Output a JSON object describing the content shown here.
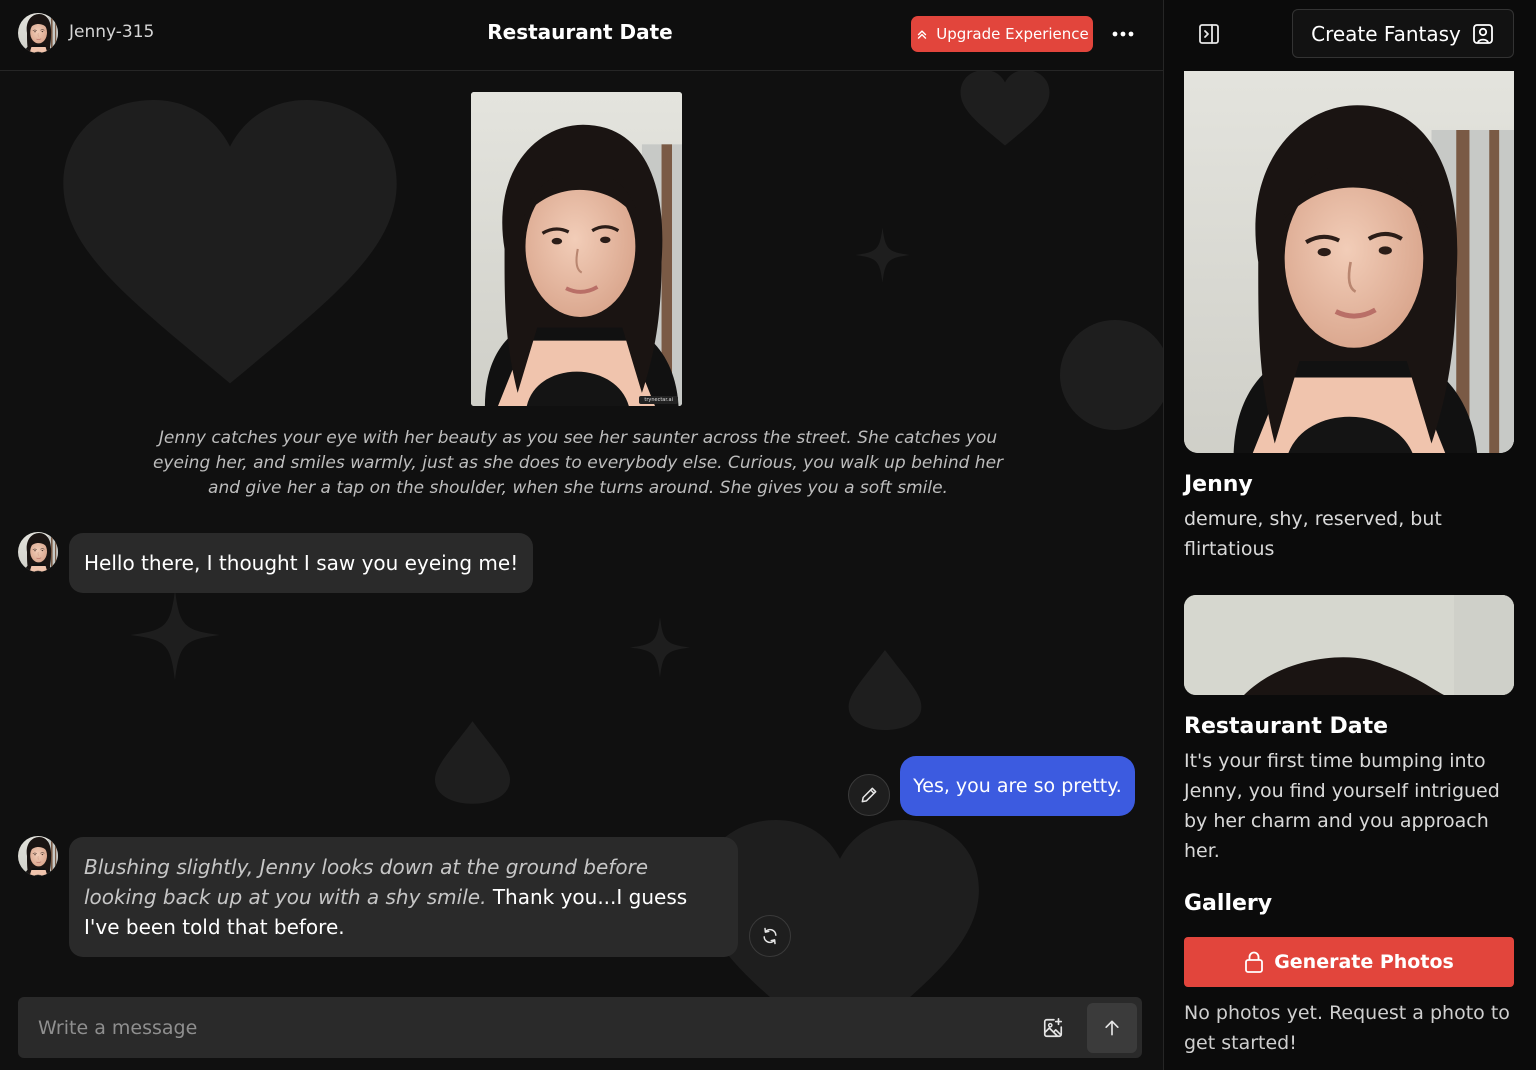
{
  "header": {
    "user_name": "Jenny-315",
    "chat_title": "Restaurant Date",
    "upgrade_label": "Upgrade Experience"
  },
  "chat": {
    "intro_text": "Jenny catches your eye with her beauty as you see her saunter across the street. She catches you eyeing her, and smiles warmly, just as she does to everybody else. Curious, you walk up behind her and give her a tap on the shoulder, when she turns around. She gives you a soft smile.",
    "intro_photo_watermark": "trynectar.ai",
    "messages": [
      {
        "role": "ai",
        "text": "Hello there, I thought I saw you eyeing me!"
      },
      {
        "role": "user",
        "text": "Yes, you are so pretty."
      },
      {
        "role": "ai",
        "narration": "Blushing slightly, Jenny looks down at the ground before looking back up at you with a shy smile.",
        "text": "Thank you...I guess I've been told that before."
      }
    ]
  },
  "composer": {
    "placeholder": "Write a message"
  },
  "sidebar": {
    "create_label": "Create Fantasy",
    "character_name": "Jenny",
    "character_desc": "demure, shy, reserved, but flirtatious",
    "scenario_title": "Restaurant Date",
    "scenario_desc": "It's your first time bumping into Jenny, you find yourself intrigued by her charm and you approach her.",
    "gallery_title": "Gallery",
    "generate_label": "Generate Photos",
    "no_photos_text": "No photos yet. Request a photo to get started!"
  },
  "colors": {
    "accent_red": "#e2453c",
    "user_bubble": "#3c5be0",
    "ai_bubble": "#2a2a2a",
    "background": "#101010"
  },
  "icons": {
    "upgrade": "double-chevron-up-icon",
    "more": "ellipsis-icon",
    "edit": "pencil-icon",
    "regenerate": "refresh-icon",
    "image_upload": "image-plus-icon",
    "send": "arrow-up-icon",
    "panel_toggle": "sidebar-toggle-icon",
    "create": "user-square-icon",
    "lock": "lock-icon"
  }
}
